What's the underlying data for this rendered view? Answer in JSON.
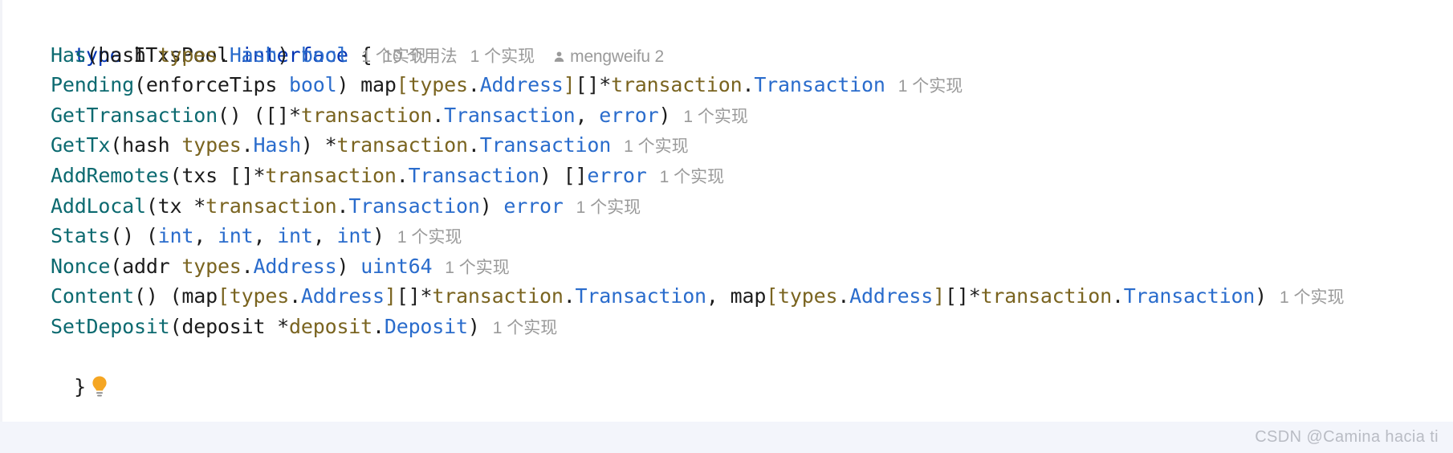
{
  "editor": {
    "language": "Go",
    "colors": {
      "keyword": "#0033b3",
      "method": "#0c6a70",
      "package": "#7a6420",
      "type": "#2a6ccc",
      "plain": "#1c1c1c",
      "hint": "#9a9a9a",
      "bulb": "#f5a623",
      "strip_background": "#f3f5fb",
      "watermark": "#b9bcc4",
      "background": "#ffffff"
    }
  },
  "declaration": {
    "keyword_type": "type",
    "name": "ITxsPool",
    "keyword_interface": "interface",
    "open_brace": "{",
    "close_brace": "}",
    "usages_hint": "10 个用法",
    "implementations_hint": "1 个实现",
    "author": "mengweifu 2",
    "author_icon": "user-icon",
    "bulb_icon": "lightbulb-icon"
  },
  "methods": [
    {
      "name": "Has",
      "signature": "(hash types.Hash) bool",
      "hint": "1 个实现",
      "tokens": [
        {
          "t": "method",
          "v": "Has"
        },
        {
          "t": "punct",
          "v": "("
        },
        {
          "t": "ident",
          "v": "hash "
        },
        {
          "t": "pkg",
          "v": "types"
        },
        {
          "t": "punct",
          "v": "."
        },
        {
          "t": "typ",
          "v": "Hash"
        },
        {
          "t": "punct",
          "v": ") "
        },
        {
          "t": "typ",
          "v": "bool"
        }
      ]
    },
    {
      "name": "Pending",
      "signature": "(enforceTips bool) map[types.Address][]*transaction.Transaction",
      "hint": "1 个实现",
      "tokens": [
        {
          "t": "method",
          "v": "Pending"
        },
        {
          "t": "punct",
          "v": "("
        },
        {
          "t": "ident",
          "v": "enforceTips "
        },
        {
          "t": "typ",
          "v": "bool"
        },
        {
          "t": "punct",
          "v": ") "
        },
        {
          "t": "ident",
          "v": "map"
        },
        {
          "t": "pkg",
          "v": "["
        },
        {
          "t": "pkg",
          "v": "types"
        },
        {
          "t": "punct",
          "v": "."
        },
        {
          "t": "typ",
          "v": "Address"
        },
        {
          "t": "pkg",
          "v": "]"
        },
        {
          "t": "punct",
          "v": "[]*"
        },
        {
          "t": "pkg",
          "v": "transaction"
        },
        {
          "t": "punct",
          "v": "."
        },
        {
          "t": "typ",
          "v": "Transaction"
        }
      ]
    },
    {
      "name": "GetTransaction",
      "signature": "() ([]*transaction.Transaction, error)",
      "hint": "1 个实现",
      "tokens": [
        {
          "t": "method",
          "v": "GetTransaction"
        },
        {
          "t": "punct",
          "v": "() ([]*"
        },
        {
          "t": "pkg",
          "v": "transaction"
        },
        {
          "t": "punct",
          "v": "."
        },
        {
          "t": "typ",
          "v": "Transaction"
        },
        {
          "t": "punct",
          "v": ", "
        },
        {
          "t": "typ",
          "v": "error"
        },
        {
          "t": "punct",
          "v": ")"
        }
      ]
    },
    {
      "name": "GetTx",
      "signature": "(hash types.Hash) *transaction.Transaction",
      "hint": "1 个实现",
      "tokens": [
        {
          "t": "method",
          "v": "GetTx"
        },
        {
          "t": "punct",
          "v": "("
        },
        {
          "t": "ident",
          "v": "hash "
        },
        {
          "t": "pkg",
          "v": "types"
        },
        {
          "t": "punct",
          "v": "."
        },
        {
          "t": "typ",
          "v": "Hash"
        },
        {
          "t": "punct",
          "v": ") *"
        },
        {
          "t": "pkg",
          "v": "transaction"
        },
        {
          "t": "punct",
          "v": "."
        },
        {
          "t": "typ",
          "v": "Transaction"
        }
      ]
    },
    {
      "name": "AddRemotes",
      "signature": "(txs []*transaction.Transaction) []error",
      "hint": "1 个实现",
      "tokens": [
        {
          "t": "method",
          "v": "AddRemotes"
        },
        {
          "t": "punct",
          "v": "("
        },
        {
          "t": "ident",
          "v": "txs "
        },
        {
          "t": "punct",
          "v": "[]*"
        },
        {
          "t": "pkg",
          "v": "transaction"
        },
        {
          "t": "punct",
          "v": "."
        },
        {
          "t": "typ",
          "v": "Transaction"
        },
        {
          "t": "punct",
          "v": ") []"
        },
        {
          "t": "typ",
          "v": "error"
        }
      ]
    },
    {
      "name": "AddLocal",
      "signature": "(tx *transaction.Transaction) error",
      "hint": "1 个实现",
      "tokens": [
        {
          "t": "method",
          "v": "AddLocal"
        },
        {
          "t": "punct",
          "v": "("
        },
        {
          "t": "ident",
          "v": "tx *"
        },
        {
          "t": "pkg",
          "v": "transaction"
        },
        {
          "t": "punct",
          "v": "."
        },
        {
          "t": "typ",
          "v": "Transaction"
        },
        {
          "t": "punct",
          "v": ") "
        },
        {
          "t": "typ",
          "v": "error"
        }
      ]
    },
    {
      "name": "Stats",
      "signature": "() (int, int, int, int)",
      "hint": "1 个实现",
      "tokens": [
        {
          "t": "method",
          "v": "Stats"
        },
        {
          "t": "punct",
          "v": "() ("
        },
        {
          "t": "typ",
          "v": "int"
        },
        {
          "t": "punct",
          "v": ", "
        },
        {
          "t": "typ",
          "v": "int"
        },
        {
          "t": "punct",
          "v": ", "
        },
        {
          "t": "typ",
          "v": "int"
        },
        {
          "t": "punct",
          "v": ", "
        },
        {
          "t": "typ",
          "v": "int"
        },
        {
          "t": "punct",
          "v": ")"
        }
      ]
    },
    {
      "name": "Nonce",
      "signature": "(addr types.Address) uint64",
      "hint": "1 个实现",
      "tokens": [
        {
          "t": "method",
          "v": "Nonce"
        },
        {
          "t": "punct",
          "v": "("
        },
        {
          "t": "ident",
          "v": "addr "
        },
        {
          "t": "pkg",
          "v": "types"
        },
        {
          "t": "punct",
          "v": "."
        },
        {
          "t": "typ",
          "v": "Address"
        },
        {
          "t": "punct",
          "v": ") "
        },
        {
          "t": "typ",
          "v": "uint64"
        }
      ]
    },
    {
      "name": "Content",
      "signature": "() (map[types.Address][]*transaction.Transaction, map[types.Address][]*transaction.Transaction)",
      "hint": "1 个实现",
      "tokens": [
        {
          "t": "method",
          "v": "Content"
        },
        {
          "t": "punct",
          "v": "() ("
        },
        {
          "t": "ident",
          "v": "map"
        },
        {
          "t": "pkg",
          "v": "["
        },
        {
          "t": "pkg",
          "v": "types"
        },
        {
          "t": "punct",
          "v": "."
        },
        {
          "t": "typ",
          "v": "Address"
        },
        {
          "t": "pkg",
          "v": "]"
        },
        {
          "t": "punct",
          "v": "[]*"
        },
        {
          "t": "pkg",
          "v": "transaction"
        },
        {
          "t": "punct",
          "v": "."
        },
        {
          "t": "typ",
          "v": "Transaction"
        },
        {
          "t": "punct",
          "v": ", "
        },
        {
          "t": "ident",
          "v": "map"
        },
        {
          "t": "pkg",
          "v": "["
        },
        {
          "t": "pkg",
          "v": "types"
        },
        {
          "t": "punct",
          "v": "."
        },
        {
          "t": "typ",
          "v": "Address"
        },
        {
          "t": "pkg",
          "v": "]"
        },
        {
          "t": "punct",
          "v": "[]*"
        },
        {
          "t": "pkg",
          "v": "transaction"
        },
        {
          "t": "punct",
          "v": "."
        },
        {
          "t": "typ",
          "v": "Transaction"
        },
        {
          "t": "punct",
          "v": ")"
        }
      ]
    },
    {
      "name": "SetDeposit",
      "signature": "(deposit *deposit.Deposit)",
      "hint": "1 个实现",
      "tokens": [
        {
          "t": "method",
          "v": "SetDeposit"
        },
        {
          "t": "punct",
          "v": "("
        },
        {
          "t": "ident",
          "v": "deposit *"
        },
        {
          "t": "pkg",
          "v": "deposit"
        },
        {
          "t": "punct",
          "v": "."
        },
        {
          "t": "typ",
          "v": "Deposit"
        },
        {
          "t": "punct",
          "v": ")"
        }
      ]
    }
  ],
  "watermark": "CSDN @Camina hacia ti"
}
